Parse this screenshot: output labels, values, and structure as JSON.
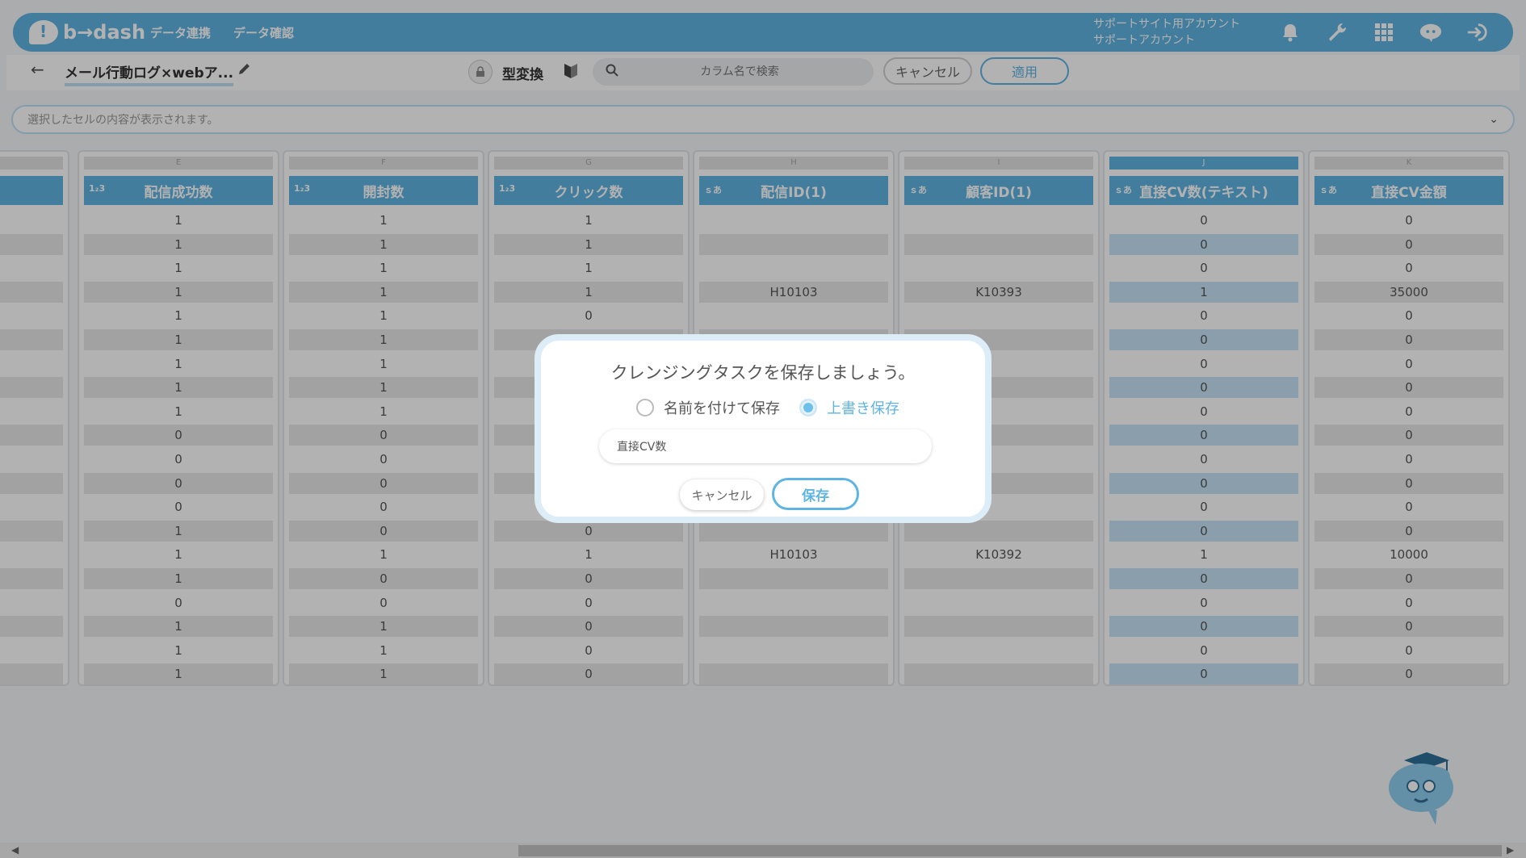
{
  "header": {
    "logo_text": "b→dash",
    "nav": [
      "データ連携",
      "データ確認"
    ],
    "account_line1": "サポートサイト用アカウント",
    "account_line2": "サポートアカウント",
    "icons": [
      "bell-icon",
      "wrench-icon",
      "apps-grid-icon",
      "mascot-badge-icon",
      "logout-icon"
    ]
  },
  "toolbar": {
    "back": "←",
    "task_name": "メール行動ログ×webア...",
    "type_conversion": "型変換",
    "search_placeholder": "カラム名で検索",
    "cancel_label": "キャンセル",
    "apply_label": "適用"
  },
  "cellbar": {
    "text": "選択したセルの内容が表示されます。",
    "chevron": "⌄"
  },
  "grid": {
    "columns": [
      {
        "letter": "",
        "type": "",
        "name": "",
        "partial": true
      },
      {
        "letter": "E",
        "type": "1₂3",
        "name": "配信成功数"
      },
      {
        "letter": "F",
        "type": "1₂3",
        "name": "開封数"
      },
      {
        "letter": "G",
        "type": "1₂3",
        "name": "クリック数"
      },
      {
        "letter": "H",
        "type": "ｓあ",
        "name": "配信ID(1)"
      },
      {
        "letter": "I",
        "type": "ｓあ",
        "name": "顧客ID(1)"
      },
      {
        "letter": "J",
        "type": "ｓあ",
        "name": "直接CV数(テキスト)",
        "selected": true
      },
      {
        "letter": "K",
        "type": "ｓあ",
        "name": "直接CV金額"
      }
    ],
    "rows": [
      [
        "",
        "1",
        "1",
        "1",
        "",
        "",
        "0",
        "0"
      ],
      [
        "",
        "1",
        "1",
        "1",
        "",
        "",
        "0",
        "0"
      ],
      [
        "",
        "1",
        "1",
        "1",
        "",
        "",
        "0",
        "0"
      ],
      [
        "",
        "1",
        "1",
        "1",
        "H10103",
        "K10393",
        "1",
        "35000"
      ],
      [
        "",
        "1",
        "1",
        "0",
        "",
        "",
        "0",
        "0"
      ],
      [
        "",
        "1",
        "1",
        "",
        "",
        "",
        "0",
        "0"
      ],
      [
        "",
        "1",
        "1",
        "",
        "",
        "",
        "0",
        "0"
      ],
      [
        "",
        "1",
        "1",
        "",
        "",
        "",
        "0",
        "0"
      ],
      [
        "",
        "1",
        "1",
        "",
        "",
        "",
        "0",
        "0"
      ],
      [
        "",
        "0",
        "0",
        "",
        "",
        "",
        "0",
        "0"
      ],
      [
        "",
        "0",
        "0",
        "",
        "",
        "",
        "0",
        "0"
      ],
      [
        "",
        "0",
        "0",
        "",
        "",
        "",
        "0",
        "0"
      ],
      [
        "",
        "0",
        "0",
        "",
        "",
        "",
        "0",
        "0"
      ],
      [
        "",
        "1",
        "0",
        "0",
        "",
        "",
        "0",
        "0"
      ],
      [
        "",
        "1",
        "1",
        "1",
        "H10103",
        "K10392",
        "1",
        "10000"
      ],
      [
        "",
        "1",
        "0",
        "0",
        "",
        "",
        "0",
        "0"
      ],
      [
        "",
        "0",
        "0",
        "0",
        "",
        "",
        "0",
        "0"
      ],
      [
        "",
        "1",
        "1",
        "0",
        "",
        "",
        "0",
        "0"
      ],
      [
        "",
        "1",
        "1",
        "0",
        "",
        "",
        "0",
        "0"
      ],
      [
        "",
        "1",
        "1",
        "0",
        "",
        "",
        "0",
        "0"
      ]
    ]
  },
  "modal": {
    "title": "クレンジングタスクを保存しましょう。",
    "option_new": "名前を付けて保存",
    "option_overwrite": "上書き保存",
    "selected_option": "上書き保存",
    "name_value": "直接CV数",
    "cancel_label": "キャンセル",
    "save_label": "保存"
  },
  "colors": {
    "brand": "#5fb4e2",
    "selected_col_cell": "#c6e2f5",
    "overlay": "rgba(0,0,0,0.30)"
  }
}
